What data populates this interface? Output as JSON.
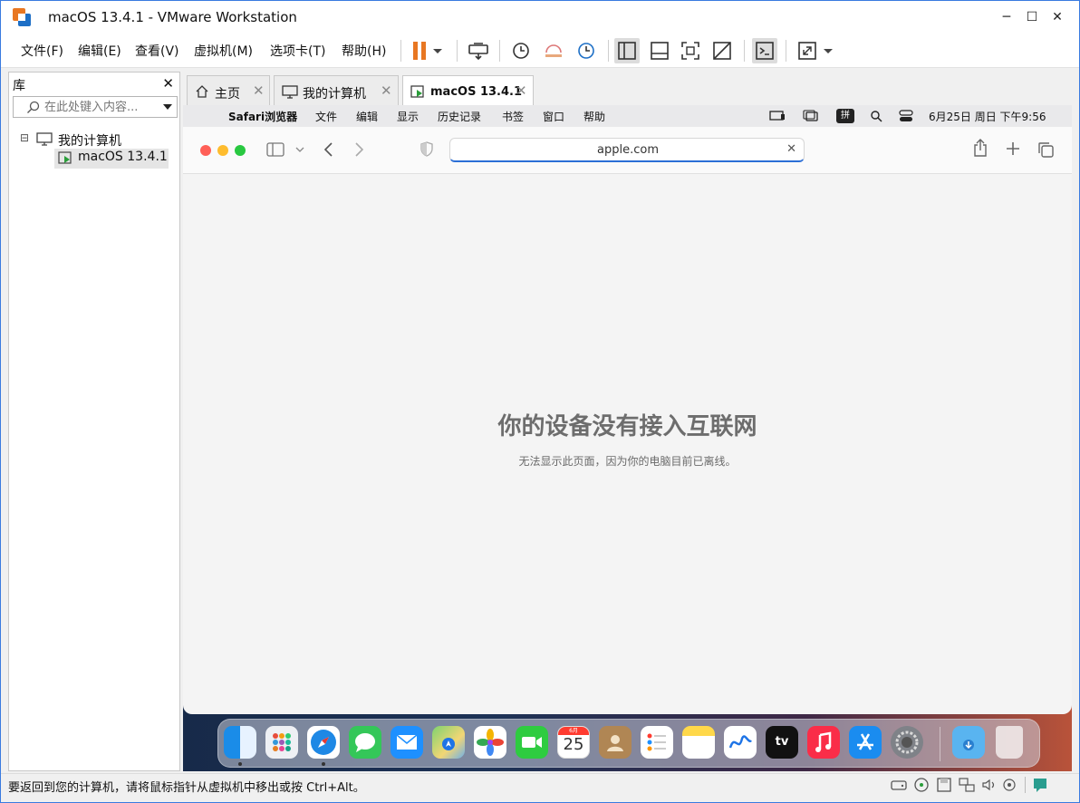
{
  "window": {
    "title": "macOS 13.4.1 - VMware Workstation",
    "minimize_glyph": "─",
    "maximize_glyph": "☐",
    "close_glyph": "✕"
  },
  "menus": [
    "文件(F)",
    "编辑(E)",
    "查看(V)",
    "虚拟机(M)",
    "选项卡(T)",
    "帮助(H)"
  ],
  "toolbar_icons": [
    "pause-icon",
    "dropdown-icon",
    "send-ctrl-alt-del-icon",
    "snapshot-icon",
    "revert-snapshot-icon",
    "snapshot-manager-icon",
    "library-view-icon",
    "thumbnail-view-icon",
    "fullscreen-icon",
    "unity-icon",
    "console-icon",
    "stretch-icon"
  ],
  "library": {
    "title": "库",
    "close_glyph": "✕",
    "search_placeholder": "在此处键入内容...",
    "tree": [
      {
        "label": "我的计算机",
        "toggle": "⊟",
        "icon": "computer-icon"
      },
      {
        "label": "macOS 13.4.1",
        "icon": "vm-running-icon"
      }
    ]
  },
  "tabs": [
    {
      "label": "主页",
      "icon": "home-icon",
      "active": false
    },
    {
      "label": "我的计算机",
      "icon": "computer-icon",
      "active": false
    },
    {
      "label": "macOS 13.4.1",
      "icon": "vm-running-icon",
      "active": true
    }
  ],
  "tab_close_glyph": "✕",
  "mac_menubar": {
    "apple": "",
    "items": [
      "Safari浏览器",
      "文件",
      "编辑",
      "显示",
      "历史记录",
      "书签",
      "窗口",
      "帮助"
    ],
    "input_method": "拼",
    "datetime": "6月25日 周日  下午9:56"
  },
  "safari": {
    "url": "apple.com",
    "clear_glyph": "✕",
    "offline_title": "你的设备没有接入互联网",
    "offline_subtitle": "无法显示此页面，因为你的电脑目前已离线。"
  },
  "dock": {
    "calendar_month": "6月",
    "calendar_day": "25",
    "tv_label": "tv",
    "apps": [
      "finder-icon",
      "launchpad-icon",
      "safari-icon",
      "messages-icon",
      "mail-icon",
      "maps-icon",
      "photos-icon",
      "facetime-icon",
      "calendar-icon",
      "contacts-icon",
      "reminders-icon",
      "notes-icon",
      "freeform-icon",
      "tv-icon",
      "music-icon",
      "app-store-icon",
      "system-settings-icon",
      "downloads-icon",
      "trash-icon"
    ]
  },
  "status": {
    "hint": "要返回到您的计算机，请将鼠标指针从虚拟机中移出或按 Ctrl+Alt。"
  },
  "colors": {
    "accent": "#2c6fd6",
    "pause": "#e87722",
    "desktop_left": "#172a49",
    "desktop_right": "#b9533a"
  }
}
